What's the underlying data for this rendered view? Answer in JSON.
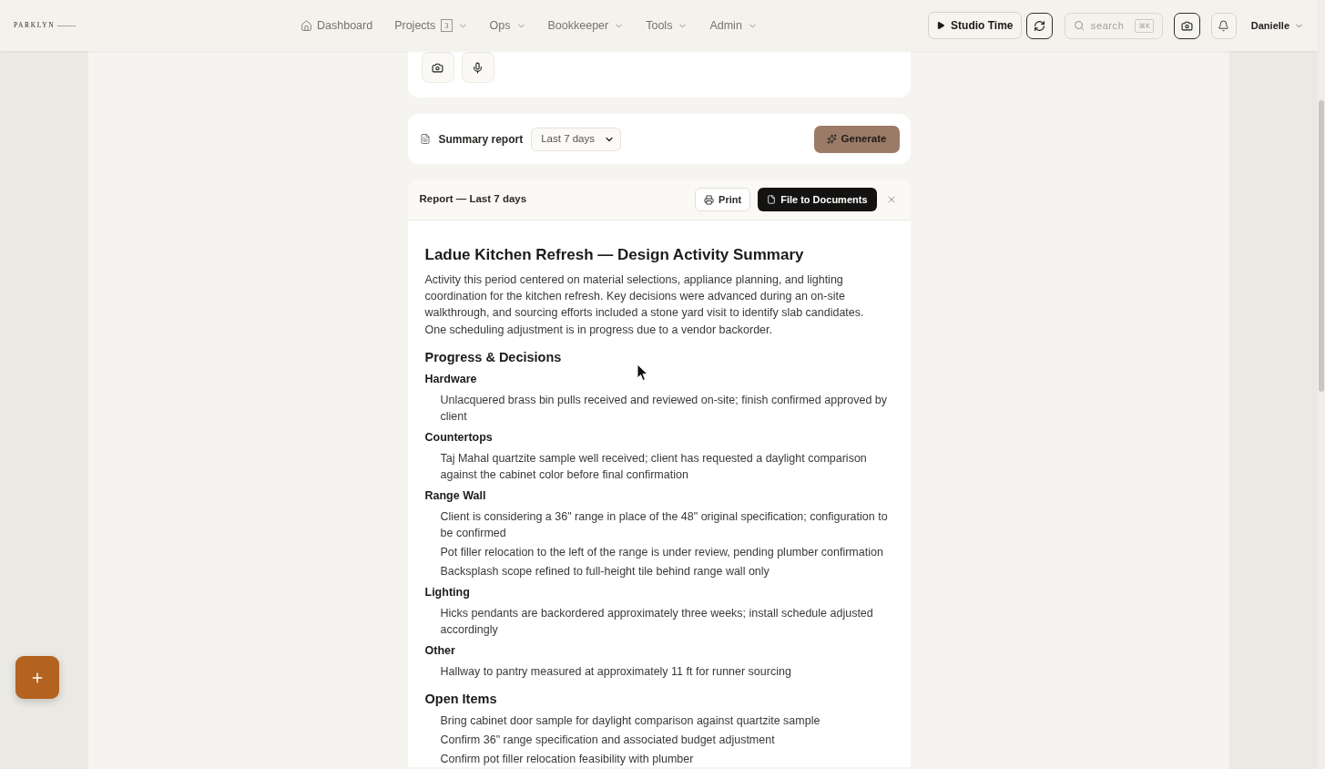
{
  "header": {
    "logo": "PARKLYN",
    "nav": [
      {
        "label": "Dashboard",
        "kind": "home"
      },
      {
        "label": "Projects",
        "kind": "menu",
        "badge": "3"
      },
      {
        "label": "Ops",
        "kind": "menu"
      },
      {
        "label": "Bookkeeper",
        "kind": "menu"
      },
      {
        "label": "Tools",
        "kind": "menu"
      },
      {
        "label": "Admin",
        "kind": "menu"
      }
    ],
    "studio_button": "Studio Time",
    "search": {
      "placeholder": "search",
      "shortcut": "⌘K"
    },
    "user": "Danielle"
  },
  "summary_bar": {
    "label": "Summary report",
    "range": "Last 7 days",
    "generate": "Generate"
  },
  "report": {
    "title_bar": "Report — Last 7 days",
    "print": "Print",
    "file": "File to Documents",
    "heading": "Ladue Kitchen Refresh — Design Activity Summary",
    "intro": "Activity this period centered on material selections, appliance planning, and lighting coordination for the kitchen refresh. Key decisions were advanced during an on-site walkthrough, and sourcing efforts included a stone yard visit to identify slab candidates. One scheduling adjustment is in progress due to a vendor backorder.",
    "sections": [
      {
        "heading": "Progress & Decisions",
        "groups": [
          {
            "heading": "Hardware",
            "items": [
              "Unlacquered brass bin pulls received and reviewed on-site; finish confirmed approved by client"
            ]
          },
          {
            "heading": "Countertops",
            "items": [
              "Taj Mahal quartzite sample well received; client has requested a daylight comparison against the cabinet color before final confirmation"
            ]
          },
          {
            "heading": "Range Wall",
            "items": [
              "Client is considering a 36\" range in place of the 48\" original specification; configuration to be confirmed",
              "Pot filler relocation to the left of the range is under review, pending plumber confirmation",
              "Backsplash scope refined to full-height tile behind range wall only"
            ]
          },
          {
            "heading": "Lighting",
            "items": [
              "Hicks pendants are backordered approximately three weeks; install schedule adjusted accordingly"
            ]
          },
          {
            "heading": "Other",
            "items": [
              "Hallway to pantry measured at approximately 11 ft for runner sourcing"
            ]
          }
        ]
      },
      {
        "heading": "Open Items",
        "items": [
          "Bring cabinet door sample for daylight comparison against quartzite sample",
          "Confirm 36\" range specification and associated budget adjustment",
          "Confirm pot filler relocation feasibility with plumber"
        ]
      }
    ]
  }
}
